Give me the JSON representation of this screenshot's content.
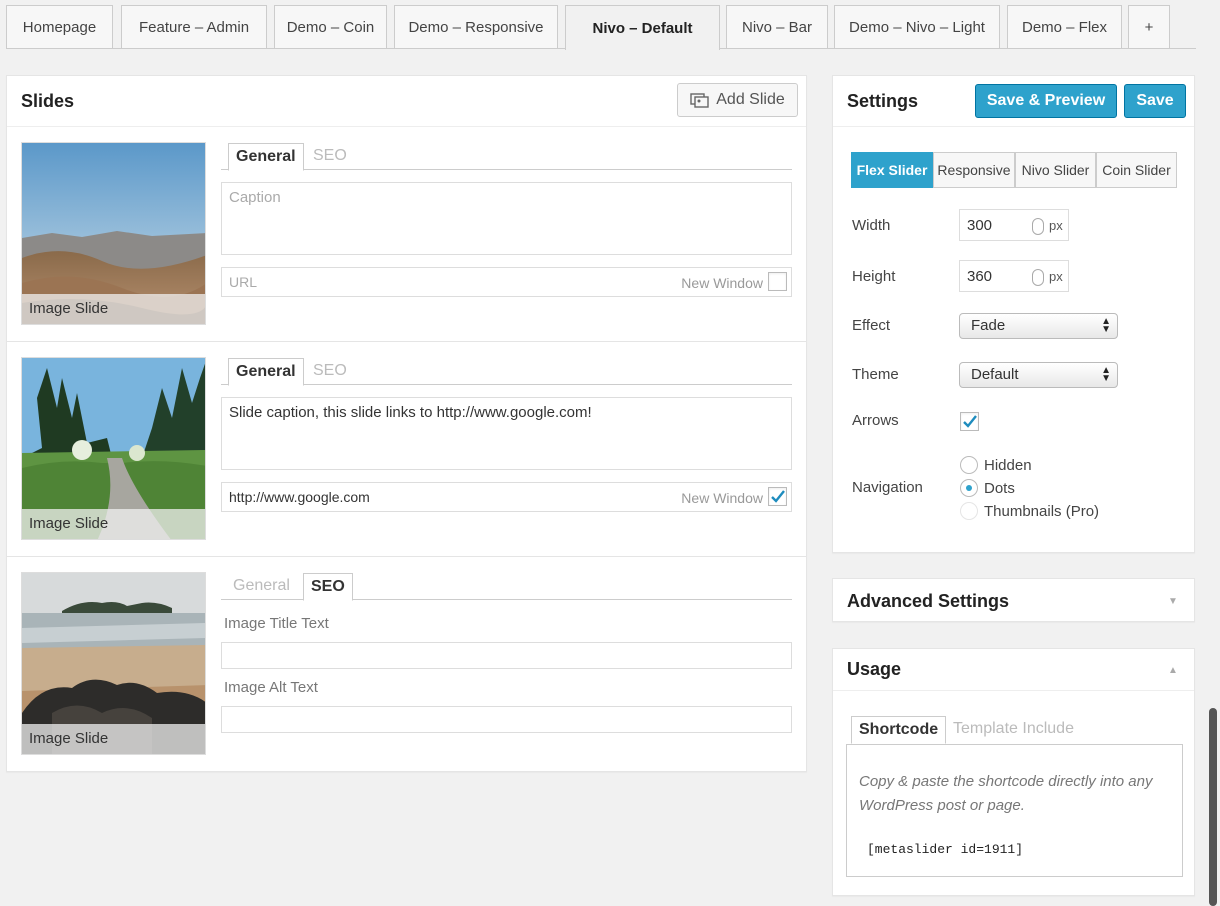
{
  "tabs": [
    "Homepage",
    "Feature – Admin",
    "Demo – Coin",
    "Demo – Responsive",
    "Nivo – Default",
    "Nivo – Bar",
    "Demo – Nivo – Light",
    "Demo – Flex",
    "+"
  ],
  "slides_panel": {
    "title": "Slides",
    "add_button": "Add Slide",
    "slides": [
      {
        "label": "Image Slide",
        "tab_general": "General",
        "tab_seo": "SEO",
        "caption_placeholder": "Caption",
        "caption_value": "",
        "url_placeholder": "URL",
        "url_value": "",
        "new_window": "New Window",
        "new_window_checked": false
      },
      {
        "label": "Image Slide",
        "tab_general": "General",
        "tab_seo": "SEO",
        "caption_value": "Slide caption, this slide links to http://www.google.com!",
        "url_value": "http://www.google.com",
        "new_window": "New Window",
        "new_window_checked": true
      },
      {
        "label": "Image Slide",
        "tab_general": "General",
        "tab_seo": "SEO",
        "title_label": "Image Title Text",
        "alt_label": "Image Alt Text"
      }
    ]
  },
  "settings": {
    "title": "Settings",
    "save_preview": "Save & Preview",
    "save": "Save",
    "slider_types": [
      "Flex Slider",
      "Responsive",
      "Nivo Slider",
      "Coin Slider"
    ],
    "width_label": "Width",
    "width_value": "300",
    "height_label": "Height",
    "height_value": "360",
    "unit": "px",
    "effect_label": "Effect",
    "effect_value": "Fade",
    "theme_label": "Theme",
    "theme_value": "Default",
    "arrows_label": "Arrows",
    "arrows_checked": true,
    "navigation_label": "Navigation",
    "navigation_options": [
      "Hidden",
      "Dots",
      "Thumbnails (Pro)"
    ],
    "navigation_selected": "Dots"
  },
  "advanced": {
    "title": "Advanced Settings"
  },
  "usage": {
    "title": "Usage",
    "tab_shortcode": "Shortcode",
    "tab_template": "Template Include",
    "line1": "Copy & paste the shortcode directly into any",
    "line2": "WordPress post or page.",
    "code": "[metaslider id=1911]"
  },
  "colors": {
    "accent": "#2ea2cc",
    "accent_border": "#0074a2"
  }
}
